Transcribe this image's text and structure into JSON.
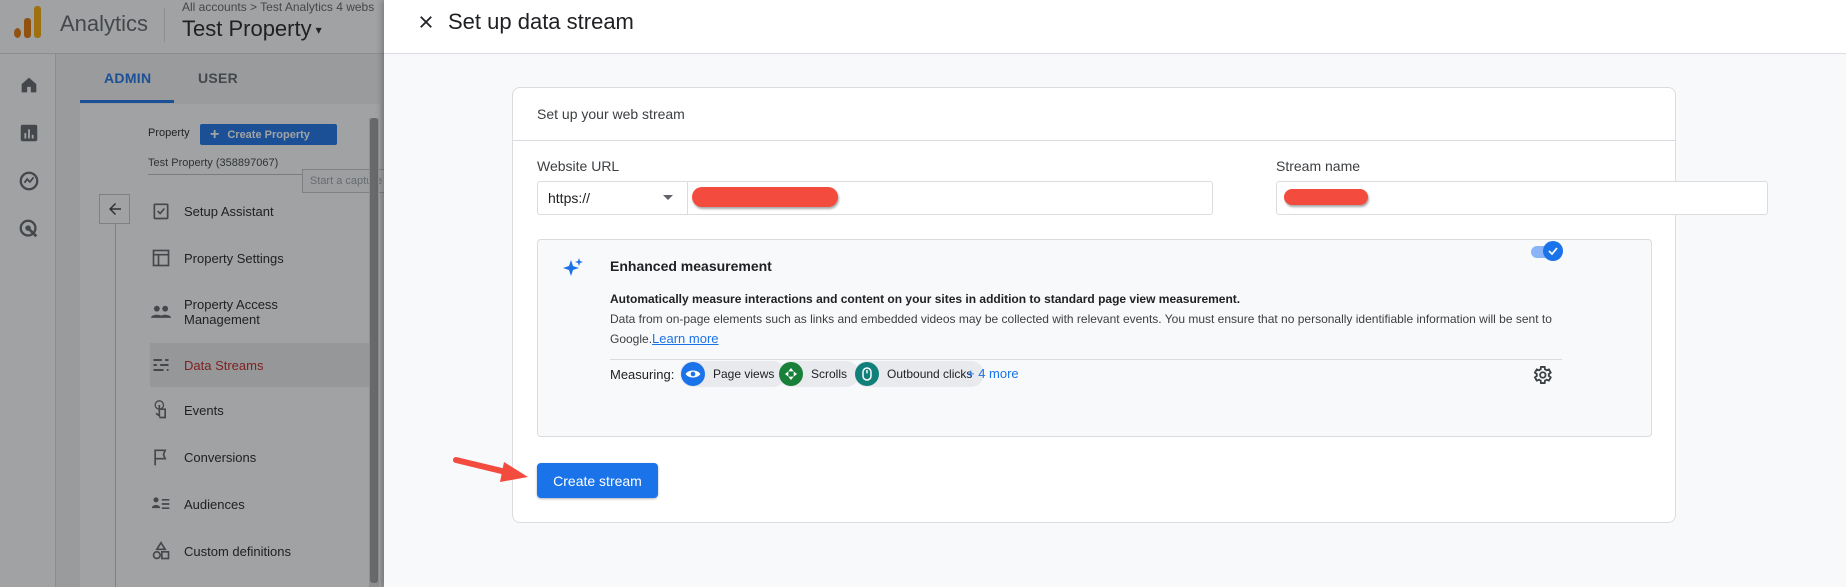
{
  "header": {
    "app_name": "Analytics",
    "breadcrumb": "All accounts > Test Analytics 4 webs",
    "property_title": "Test Property",
    "caret": "▾"
  },
  "tabs": {
    "admin": "ADMIN",
    "user": "USER"
  },
  "admin": {
    "property_label": "Property",
    "create_property": "Create Property",
    "property_sub": "Test Property (358897067)",
    "capture_tip": "Start a capture",
    "nav": [
      {
        "label": "Setup Assistant",
        "icon": "checklist-icon"
      },
      {
        "label": "Property Settings",
        "icon": "settings-window-icon"
      },
      {
        "label": "Property Access Management",
        "icon": "people-icon"
      },
      {
        "label": "Data Streams",
        "icon": "streams-icon",
        "active": true
      },
      {
        "label": "Events",
        "icon": "touch-icon"
      },
      {
        "label": "Conversions",
        "icon": "flag-icon"
      },
      {
        "label": "Audiences",
        "icon": "audience-icon"
      },
      {
        "label": "Custom definitions",
        "icon": "shapes-icon"
      }
    ]
  },
  "panel": {
    "title": "Set up data stream",
    "card_title": "Set up your web stream",
    "website_url_label": "Website URL",
    "protocol": "https://",
    "stream_name_label": "Stream name",
    "enhanced": {
      "title": "Enhanced measurement",
      "desc_bold": "Automatically measure interactions and content on your sites in addition to standard page view measurement.",
      "desc": "Data from on-page elements such as links and embedded videos may be collected with relevant events. You must ensure that no personally identifiable information will be sent to Google.",
      "learn_more": "Learn more",
      "toggle_on": true,
      "measuring_label": "Measuring:",
      "chips": [
        "Page views",
        "Scrolls",
        "Outbound clicks"
      ],
      "more": "+ 4 more"
    },
    "create_button": "Create stream"
  },
  "colors": {
    "primary": "#1a73e8",
    "active_nav_text": "#c5221f",
    "redaction": "#f44b3f",
    "chip_page_views": "#1a73e8",
    "chip_scrolls": "#188038",
    "chip_outbound": "#12807a"
  }
}
